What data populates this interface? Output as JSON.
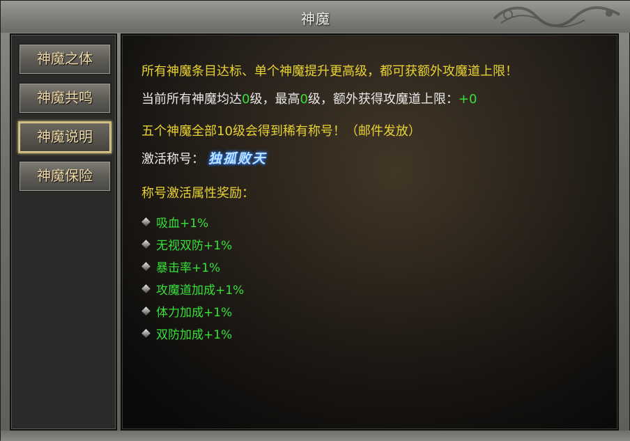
{
  "window": {
    "title": "神魔"
  },
  "sidebar": {
    "items": [
      {
        "label": "神魔之体",
        "active": false
      },
      {
        "label": "神魔共鸣",
        "active": false
      },
      {
        "label": "神魔说明",
        "active": true
      },
      {
        "label": "神魔保险",
        "active": false
      }
    ]
  },
  "content": {
    "line1": "所有神魔条目达标、单个神魔提升更高级，都可获额外攻魔道上限！",
    "line2": {
      "part1": "当前所有神魔均达",
      "level_all": "0",
      "part2": "级，最高",
      "level_max": "0",
      "part3": "级，额外获得攻魔道上限：",
      "bonus": "+0"
    },
    "line3": "五个神魔全部10级会得到稀有称号！（邮件发放）",
    "activate_label": "激活称号：",
    "title_name": "独孤败天",
    "reward_header": "称号激活属性奖励：",
    "rewards": [
      "吸血+1%",
      "无视双防+1%",
      "暴击率+1%",
      "攻魔道加成+1%",
      "体力加成+1%",
      "双防加成+1%"
    ]
  },
  "colors": {
    "highlight_yellow": "#e8d233",
    "value_green": "#38e03a",
    "title_blue": "#bfe3ff"
  }
}
